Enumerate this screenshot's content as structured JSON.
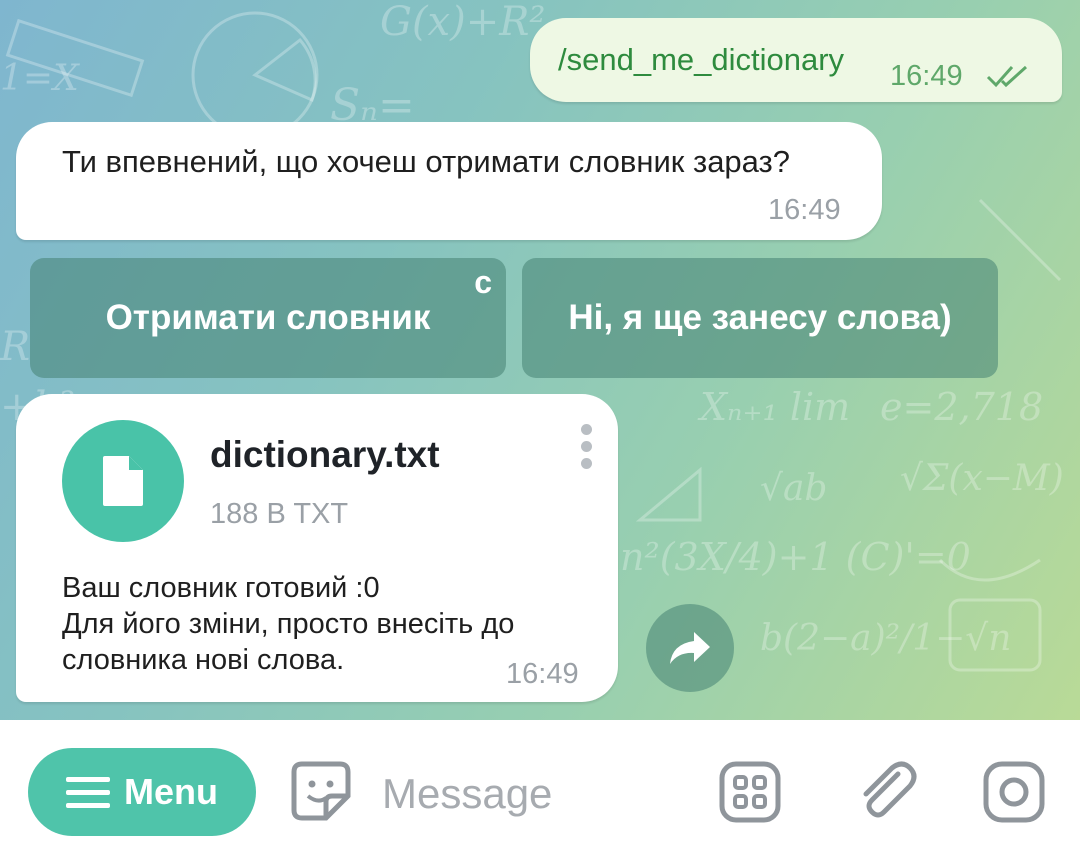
{
  "outgoing": {
    "text": "/send_me_dictionary",
    "time": "16:49",
    "status_icon": "double-check-icon"
  },
  "incoming_question": {
    "text": "Ти впевнений, що хочеш отримати словник зараз?",
    "time": "16:49"
  },
  "keyboard": {
    "buttons": [
      {
        "label": "Отримати словник",
        "corner_glyph": "c"
      },
      {
        "label": "Ні, я ще занесу слова)"
      }
    ]
  },
  "file_message": {
    "file_name": "dictionary.txt",
    "file_meta": "188 B TXT",
    "caption_lines": [
      "Ваш словник готовий :0",
      "Для його зміни, просто внесіть до",
      "словника нові слова."
    ],
    "time": "16:49"
  },
  "input_bar": {
    "menu_label": "Menu",
    "placeholder": "Message"
  },
  "colors": {
    "accent": "#4fc4aa",
    "outgoing_bubble": "#eef8e4",
    "outgoing_text": "#2e8b3e"
  },
  "icons": [
    "double-check-icon",
    "file-icon",
    "more-vertical-icon",
    "share-icon",
    "menu-icon",
    "sticker-icon",
    "bot-commands-icon",
    "attach-icon",
    "camera-icon"
  ]
}
